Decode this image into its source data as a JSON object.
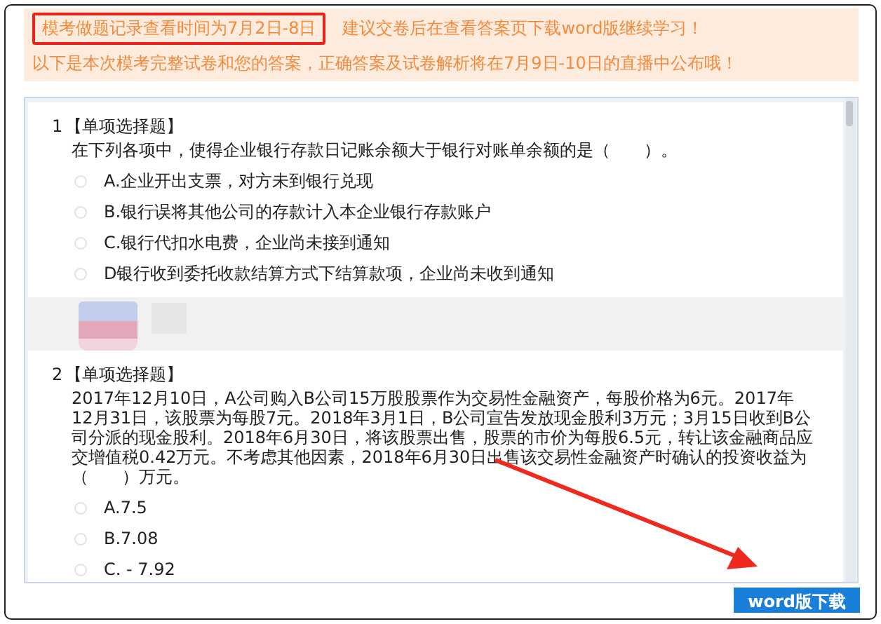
{
  "notice": {
    "highlight": "模考做题记录查看时间为7月2日-8日",
    "tip": "建议交卷后在查看答案页下载word版继续学习！",
    "info": "以下是本次模考完整试卷和您的答案，正确答案及试卷解析将在7月9日-10日的直播中公布哦！"
  },
  "questions": [
    {
      "number": "1",
      "type": "【单项选择题】",
      "stem": "在下列各项中，使得企业银行存款日记账余额大于银行对账单余额的是（　　）。",
      "options": [
        {
          "label": "A.企业开出支票，对方未到银行兑现",
          "selected": false
        },
        {
          "label": "B.银行误将其他公司的存款计入本企业银行存款账户",
          "selected": false
        },
        {
          "label": "C.银行代扣水电费，企业尚未接到通知",
          "selected": false
        },
        {
          "label": "D银行收到委托收款结算方式下结算款项，企业尚未收到通知",
          "selected": false
        }
      ]
    },
    {
      "number": "2",
      "type": "【单项选择题】",
      "stem": "2017年12月10日，A公司购入B公司15万股股票作为交易性金融资产，每股价格为6元。2017年12月31日，该股票为每股7元。2018年3月1日，B公司宣告发放现金股利3万元；3月15日收到B公司分派的现金股利。2018年6月30日，将该股票出售，股票的市价为每股6.5元，转让该金融商品应交增值税0.42万元。不考虑其他因素，2018年6月30日出售该交易性金融资产时确认的投资收益为（　　）万元。",
      "options": [
        {
          "label": "A.7.5",
          "selected": false
        },
        {
          "label": "B.7.08",
          "selected": false
        },
        {
          "label": "C. - 7.92",
          "selected": false
        }
      ]
    }
  ],
  "download_button": "word版下载"
}
